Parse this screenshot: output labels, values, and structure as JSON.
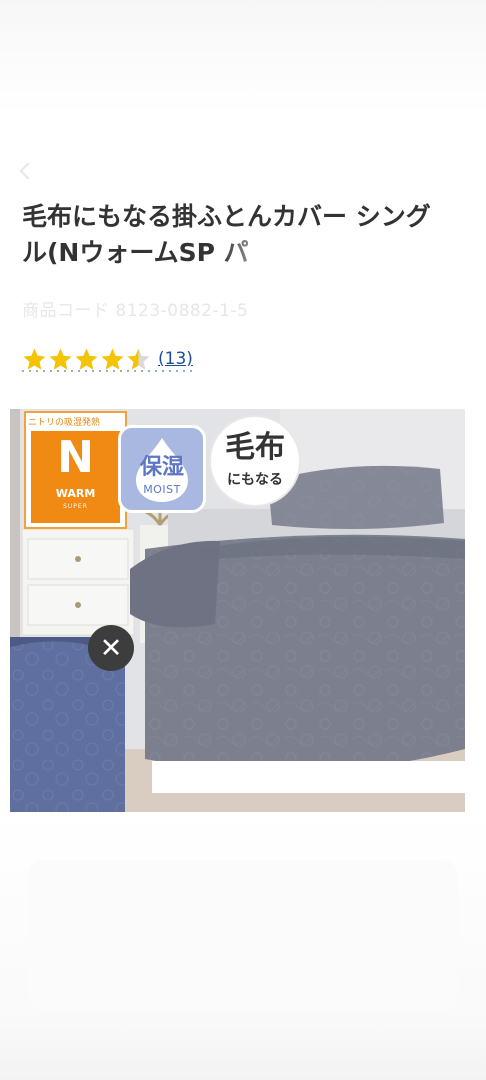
{
  "product": {
    "title": "毛布にもなる掛ふとんカバー シングル(Nウォーム SP",
    "title_line1": "毛布にもなる掛ふとんカバー シング",
    "title_line2": "ル(NウォームSP パ",
    "product_code": "商品コード 8123-0882-1-5 ",
    "rating": 4.5,
    "review_count": "(13)"
  },
  "image": {
    "badge_nwarm_caption": "ニトリの吸湿発熱",
    "badge_nwarm_letter": "N",
    "badge_nwarm_warm": "WARM",
    "badge_nwarm_super": "SUPER",
    "badge_moist_jp": "保湿",
    "badge_moist_en": "MOIST",
    "badge_blanket_line1": "毛布",
    "badge_blanket_line2": "にもなる"
  },
  "colors": {
    "title": "#333333",
    "star": "#f5c400",
    "review_link": "#1d4f99",
    "badge_orange": "#f08a12",
    "badge_blue": "#a8b8e0",
    "comforter": "#7b7f8e"
  },
  "icons": {
    "star": "star-icon",
    "close": "close-icon"
  }
}
